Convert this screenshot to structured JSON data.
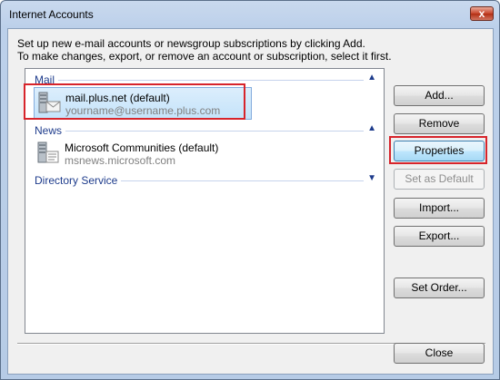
{
  "window": {
    "title": "Internet Accounts",
    "close_glyph": "x"
  },
  "instructions": {
    "line1": "Set up new e-mail accounts or newsgroup subscriptions by clicking Add.",
    "line2": "To make changes, export, or remove an account or subscription, select it first."
  },
  "groups": [
    {
      "label": "Mail",
      "chevron": "▲",
      "accounts": [
        {
          "name": "mail.plus.net (default)",
          "address": "yourname@username.plus.com",
          "icon": "mail-server-icon",
          "selected": true
        }
      ]
    },
    {
      "label": "News",
      "chevron": "▲",
      "accounts": [
        {
          "name": "Microsoft Communities (default)",
          "address": "msnews.microsoft.com",
          "icon": "news-server-icon",
          "selected": false
        }
      ]
    },
    {
      "label": "Directory Service",
      "chevron": "▼",
      "accounts": []
    }
  ],
  "buttons": {
    "add": "Add...",
    "remove": "Remove",
    "properties": "Properties",
    "set_default": "Set as Default",
    "import": "Import...",
    "export": "Export...",
    "set_order": "Set Order...",
    "close": "Close"
  },
  "colors": {
    "highlight_box": "#d7242b",
    "group_header": "#1e3c8c",
    "selection": "#c4e3fa"
  }
}
